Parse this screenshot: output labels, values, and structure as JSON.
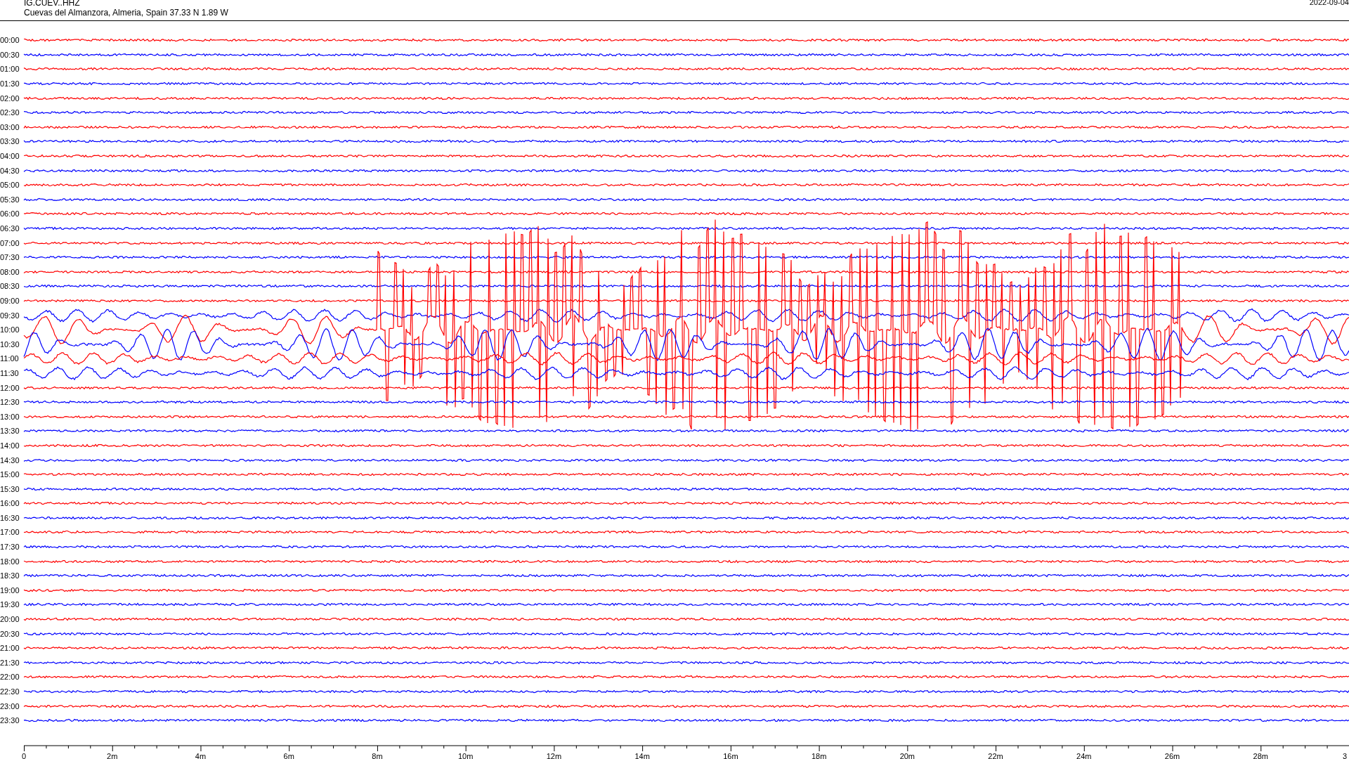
{
  "header": {
    "station": "IG.CUEV..HHZ",
    "location": "Cuevas del Almanzora, Almeria, Spain  37.33 N 1.89 W",
    "date": "2022-09-04"
  },
  "traces": [
    {
      "time": "00:00",
      "color": "#ff0000",
      "kind": "quiet"
    },
    {
      "time": "00:30",
      "color": "#0000ff",
      "kind": "quiet"
    },
    {
      "time": "01:00",
      "color": "#ff0000",
      "kind": "quiet"
    },
    {
      "time": "01:30",
      "color": "#0000ff",
      "kind": "quiet"
    },
    {
      "time": "02:00",
      "color": "#ff0000",
      "kind": "quiet"
    },
    {
      "time": "02:30",
      "color": "#0000ff",
      "kind": "quiet"
    },
    {
      "time": "03:00",
      "color": "#ff0000",
      "kind": "quiet"
    },
    {
      "time": "03:30",
      "color": "#0000ff",
      "kind": "quiet"
    },
    {
      "time": "04:00",
      "color": "#ff0000",
      "kind": "quiet"
    },
    {
      "time": "04:30",
      "color": "#0000ff",
      "kind": "quiet"
    },
    {
      "time": "05:00",
      "color": "#ff0000",
      "kind": "quiet"
    },
    {
      "time": "05:30",
      "color": "#0000ff",
      "kind": "quiet"
    },
    {
      "time": "06:00",
      "color": "#ff0000",
      "kind": "quiet"
    },
    {
      "time": "06:30",
      "color": "#0000ff",
      "kind": "quiet"
    },
    {
      "time": "07:00",
      "color": "#ff0000",
      "kind": "quiet"
    },
    {
      "time": "07:30",
      "color": "#0000ff",
      "kind": "quiet"
    },
    {
      "time": "08:00",
      "color": "#ff0000",
      "kind": "quiet"
    },
    {
      "time": "08:30",
      "color": "#0000ff",
      "kind": "quiet"
    },
    {
      "time": "09:00",
      "color": "#ff0000",
      "kind": "quiet"
    },
    {
      "time": "09:30",
      "color": "#0000ff",
      "kind": "small"
    },
    {
      "time": "10:00",
      "color": "#ff0000",
      "kind": "spikes"
    },
    {
      "time": "10:30",
      "color": "#0000ff",
      "kind": "large"
    },
    {
      "time": "11:00",
      "color": "#ff0000",
      "kind": "small"
    },
    {
      "time": "11:30",
      "color": "#0000ff",
      "kind": "small"
    },
    {
      "time": "12:00",
      "color": "#ff0000",
      "kind": "quiet"
    },
    {
      "time": "12:30",
      "color": "#0000ff",
      "kind": "quiet"
    },
    {
      "time": "13:00",
      "color": "#ff0000",
      "kind": "quiet"
    },
    {
      "time": "13:30",
      "color": "#0000ff",
      "kind": "quiet"
    },
    {
      "time": "14:00",
      "color": "#ff0000",
      "kind": "quiet"
    },
    {
      "time": "14:30",
      "color": "#0000ff",
      "kind": "quiet"
    },
    {
      "time": "15:00",
      "color": "#ff0000",
      "kind": "quiet"
    },
    {
      "time": "15:30",
      "color": "#0000ff",
      "kind": "quiet"
    },
    {
      "time": "16:00",
      "color": "#ff0000",
      "kind": "quiet"
    },
    {
      "time": "16:30",
      "color": "#0000ff",
      "kind": "quiet"
    },
    {
      "time": "17:00",
      "color": "#ff0000",
      "kind": "quiet"
    },
    {
      "time": "17:30",
      "color": "#0000ff",
      "kind": "quiet"
    },
    {
      "time": "18:00",
      "color": "#ff0000",
      "kind": "quiet"
    },
    {
      "time": "18:30",
      "color": "#0000ff",
      "kind": "quiet"
    },
    {
      "time": "19:00",
      "color": "#ff0000",
      "kind": "quiet"
    },
    {
      "time": "19:30",
      "color": "#0000ff",
      "kind": "quiet"
    },
    {
      "time": "20:00",
      "color": "#ff0000",
      "kind": "quiet"
    },
    {
      "time": "20:30",
      "color": "#0000ff",
      "kind": "quiet"
    },
    {
      "time": "21:00",
      "color": "#ff0000",
      "kind": "quiet"
    },
    {
      "time": "21:30",
      "color": "#0000ff",
      "kind": "quiet"
    },
    {
      "time": "22:00",
      "color": "#ff0000",
      "kind": "quiet"
    },
    {
      "time": "22:30",
      "color": "#0000ff",
      "kind": "quiet"
    },
    {
      "time": "23:00",
      "color": "#ff0000",
      "kind": "quiet"
    },
    {
      "time": "23:30",
      "color": "#0000ff",
      "kind": "quiet"
    }
  ],
  "x_axis": {
    "labels": [
      "0",
      "2m",
      "4m",
      "6m",
      "8m",
      "10m",
      "12m",
      "14m",
      "16m",
      "18m",
      "20m",
      "22m",
      "24m",
      "26m",
      "28m",
      "3"
    ]
  }
}
